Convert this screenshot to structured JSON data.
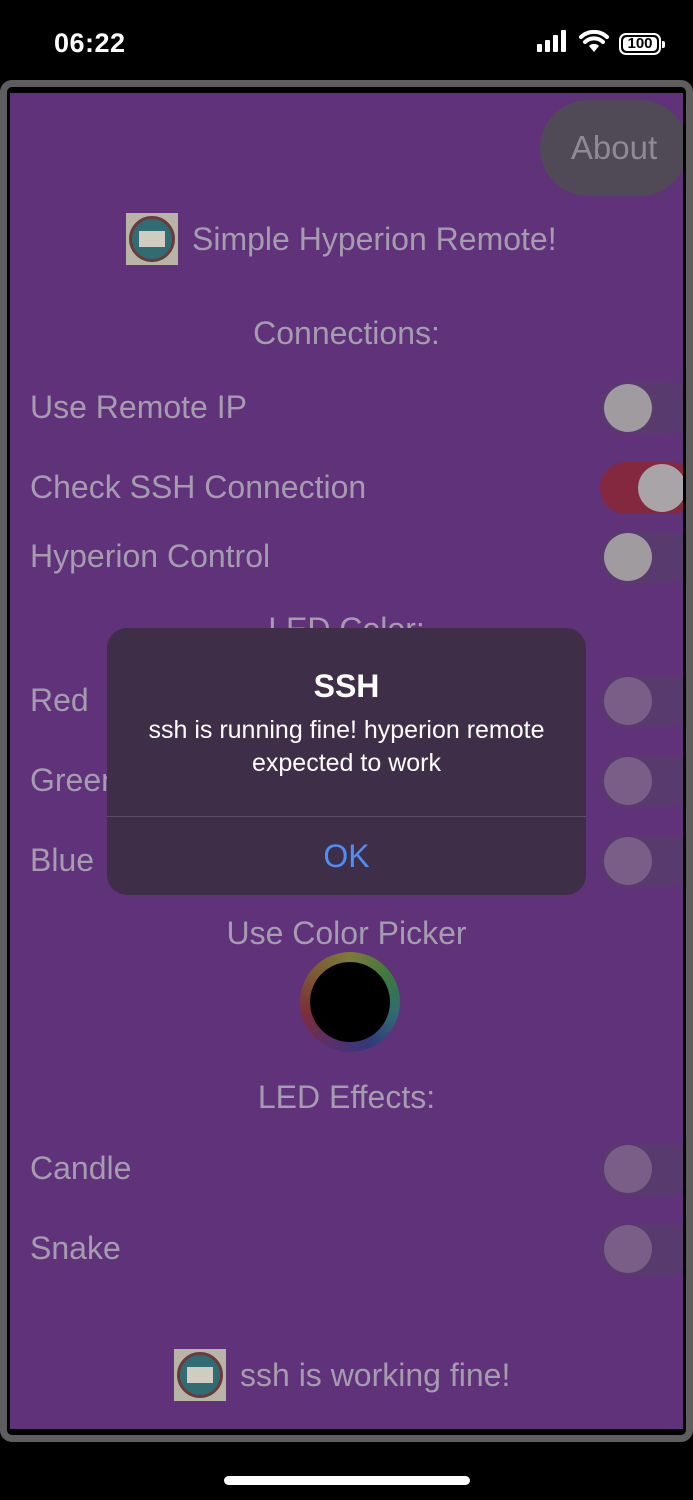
{
  "status_bar": {
    "time": "06:22",
    "battery": "100",
    "icons": [
      "cellular-signal-icon",
      "wifi-icon",
      "battery-icon"
    ]
  },
  "app": {
    "about_label": "About",
    "title": "Simple Hyperion Remote!",
    "connections": {
      "heading": "Connections:",
      "items": [
        {
          "label": "Use Remote IP",
          "on": false
        },
        {
          "label": "Check SSH Connection",
          "on": true
        },
        {
          "label": "Hyperion Control",
          "on": false
        }
      ]
    },
    "led_color": {
      "heading": "LED Color:",
      "items": [
        {
          "label": "Red",
          "on": false
        },
        {
          "label": "Green",
          "on": false
        },
        {
          "label": "Blue",
          "on": false
        }
      ],
      "picker_label": "Use Color Picker"
    },
    "led_effects": {
      "heading": "LED Effects:",
      "items": [
        {
          "label": "Candle",
          "on": false
        },
        {
          "label": "Snake",
          "on": false
        }
      ]
    },
    "footer_status": "ssh is working fine!"
  },
  "dialog": {
    "title": "SSH",
    "message": "ssh is running fine! hyperion remote expected to work",
    "ok_label": "OK"
  },
  "colors": {
    "background": "#5f3279",
    "toggle_on": "#84283f",
    "dialog_bg": "#3e2e48",
    "dialog_button": "#4d8ff6"
  }
}
